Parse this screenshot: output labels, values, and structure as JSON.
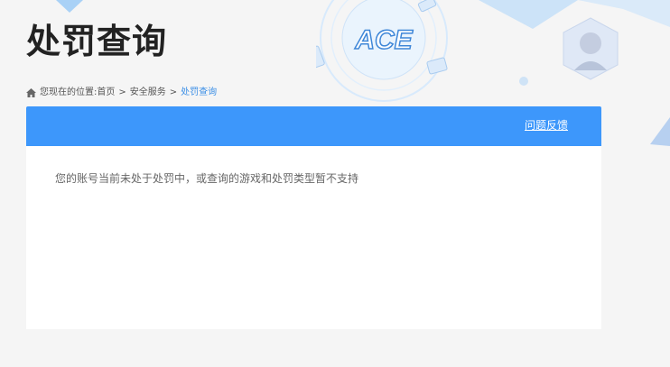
{
  "page": {
    "title": "处罚查询"
  },
  "breadcrumb": {
    "prefix": "您现在的位置:",
    "items": [
      "首页",
      "安全服务"
    ],
    "current": "处罚查询",
    "separator": ">"
  },
  "header_bar": {
    "feedback_label": "问题反馈"
  },
  "content": {
    "message": "您的账号当前未处于处罚中，或查询的游戏和处罚类型暂不支持"
  },
  "logo": {
    "text": "ACE"
  },
  "colors": {
    "accent": "#3d97fb",
    "breadcrumb_current": "#3a8ee6",
    "background": "#f5f5f5"
  }
}
